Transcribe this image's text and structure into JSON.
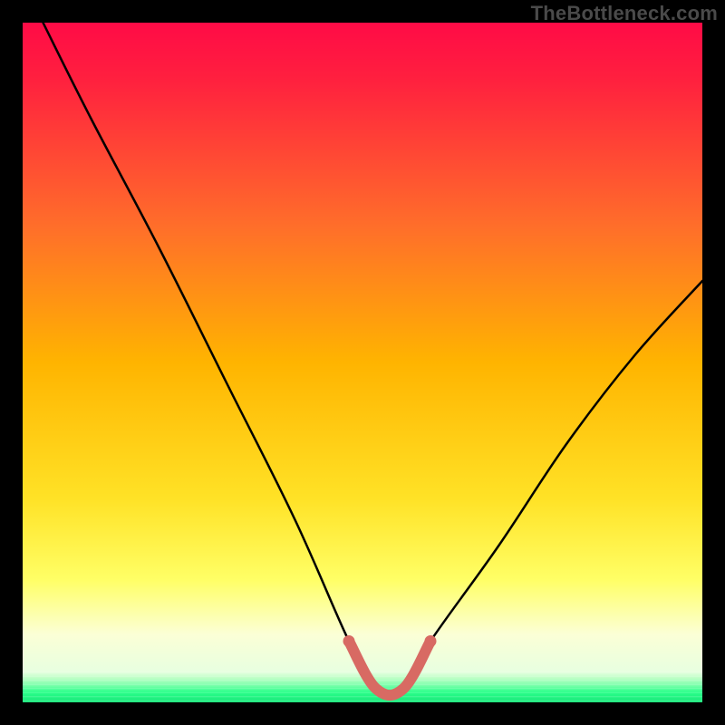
{
  "watermark": "TheBottleneck.com",
  "colors": {
    "top": "#ff0b46",
    "mid": "#ffb400",
    "lower": "#ffff66",
    "pale": "#fbffd6",
    "baseGreen": "#2bff8a",
    "curveBlack": "#000000",
    "thickRed": "#d86a63"
  },
  "chart_data": {
    "type": "line",
    "title": "",
    "xlabel": "",
    "ylabel": "",
    "xlim": [
      0,
      100
    ],
    "ylim": [
      0,
      100
    ],
    "series": [
      {
        "name": "bottleneck-curve",
        "x": [
          3,
          10,
          20,
          30,
          40,
          48,
          52,
          56,
          60,
          70,
          80,
          90,
          100
        ],
        "y": [
          100,
          86,
          67,
          47,
          27,
          9,
          2,
          2,
          9,
          23,
          38,
          51,
          62
        ]
      }
    ],
    "highlight_segment": {
      "name": "optimal-range",
      "x": [
        48,
        52,
        56,
        60
      ],
      "y": [
        9,
        2,
        2,
        9
      ]
    }
  }
}
